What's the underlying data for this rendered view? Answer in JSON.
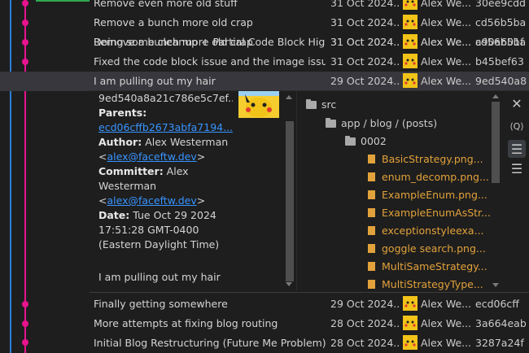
{
  "colors": {
    "graph_blue": "#2e7dd6",
    "graph_pink": "#e8138e",
    "graph_green": "#2fa84f"
  },
  "commits_top": [
    {
      "message": "Remove even more old stuff",
      "date": "31 Oct 2024...",
      "author": "Alex We...",
      "hash": "30ee9cdd"
    },
    {
      "message": "Remove a bunch more old crap",
      "date": "31 Oct 2024...",
      "author": "Alex We...",
      "hash": "cd56b5ba"
    },
    {
      "message": "Doing some cleanup + Partial Code Block Highl...",
      "date": "31 Oct 2024...",
      "author": "Alex We...",
      "hash": "a90a601f"
    },
    {
      "message": "Fixed the code block issue and the image issue",
      "date": "31 Oct 2024...",
      "author": "Alex We...",
      "hash": "b45bef63"
    },
    {
      "message": "I am pulling out my hair",
      "date": "29 Oct 2024...",
      "author": "Alex We...",
      "hash": "9ed540a8"
    }
  ],
  "details": {
    "full_hash": "9ed540a8a21c786e5c7ef...",
    "parents_label": "Parents:",
    "parent_hash": "ecd06cffb2673abfa7194...",
    "author_label": "Author:",
    "author_name": "Alex Westerman",
    "author_email": "alex@faceftw.dev",
    "committer_label": "Committer:",
    "committer_name_1": "Alex",
    "committer_name_2": "Westerman",
    "committer_email": "alex@faceftw.dev",
    "date_label": "Date:",
    "date_1": "Tue Oct 29 2024",
    "date_2": "17:51:28 GMT-0400",
    "date_3": "(Eastern Daylight Time)",
    "message": "I am pulling out my hair"
  },
  "file_tree": {
    "root": "src",
    "path": "app / blog / (posts)",
    "sub": "0002",
    "files": [
      "BasicStrategy.png...",
      "enum_decomp.png...",
      "ExampleEnum.png...",
      "ExampleEnumAsStr...",
      "exceptionstyleexa...",
      "goggle search.png...",
      "MultiSameStrategy...",
      "MultiStrategyType..."
    ]
  },
  "actions": [
    {
      "icon": "close-icon",
      "glyph": "✕"
    },
    {
      "icon": "open-in-view-icon",
      "glyph": "⟨Q⟩"
    },
    {
      "icon": "tree-view-icon",
      "glyph": "☰"
    },
    {
      "icon": "list-view-icon",
      "glyph": "☰"
    }
  ],
  "commits_bottom": [
    {
      "message": "Finally getting somewhere",
      "date": "29 Oct 2024...",
      "author": "Alex We...",
      "hash": "ecd06cff"
    },
    {
      "message": "More attempts at fixing blog routing",
      "date": "28 Oct 2024...",
      "author": "Alex We...",
      "hash": "3a664eab"
    },
    {
      "message": "Initial Blog Restructuring (Future Me Problem)",
      "date": "28 Oct 2024...",
      "author": "Alex We...",
      "hash": "3287a24f"
    }
  ]
}
